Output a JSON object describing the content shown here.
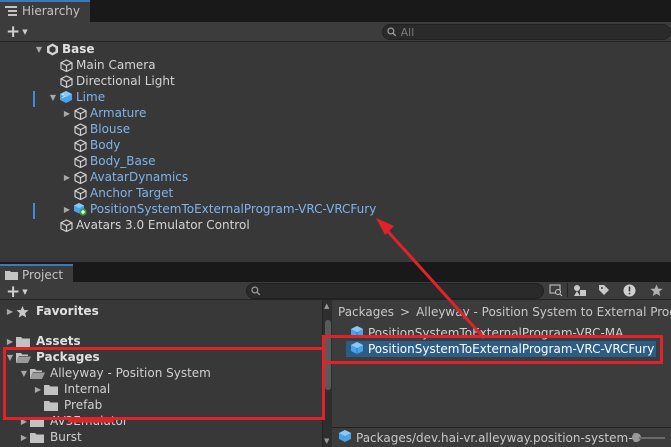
{
  "hierarchy": {
    "tab_label": "Hierarchy",
    "search_placeholder": "All",
    "rows": [
      {
        "label": "Base",
        "style": "bold",
        "icon": "unity-scene-icon",
        "arrow": "▼",
        "depth": 0
      },
      {
        "label": "Main Camera",
        "style": "white",
        "icon": "cube-outline-icon",
        "arrow": "",
        "depth": 1
      },
      {
        "label": "Directional Light",
        "style": "white",
        "icon": "cube-outline-icon",
        "arrow": "",
        "depth": 1
      },
      {
        "label": "Lime",
        "style": "blue",
        "icon": "prefab-cube-icon",
        "arrow": "▼",
        "depth": 1
      },
      {
        "label": "Armature",
        "style": "blue",
        "icon": "cube-outline-icon",
        "arrow": "▶",
        "depth": 2
      },
      {
        "label": "Blouse",
        "style": "blue",
        "icon": "cube-outline-icon",
        "arrow": "",
        "depth": 2
      },
      {
        "label": "Body",
        "style": "blue",
        "icon": "cube-outline-icon",
        "arrow": "",
        "depth": 2
      },
      {
        "label": "Body_Base",
        "style": "blue",
        "icon": "cube-outline-icon",
        "arrow": "",
        "depth": 2
      },
      {
        "label": "AvatarDynamics",
        "style": "blue",
        "icon": "cube-outline-icon",
        "arrow": "▶",
        "depth": 2
      },
      {
        "label": "Anchor Target",
        "style": "blue",
        "icon": "cube-outline-icon",
        "arrow": "",
        "depth": 2
      },
      {
        "label": "PositionSystemToExternalProgram-VRC-VRCFury",
        "style": "blue",
        "icon": "prefab-added-icon",
        "arrow": "▶",
        "depth": 2
      },
      {
        "label": "Avatars 3.0 Emulator Control",
        "style": "white",
        "icon": "cube-outline-icon",
        "arrow": "",
        "depth": 1
      }
    ]
  },
  "project": {
    "tab_label": "Project",
    "tree": [
      {
        "label": "Favorites",
        "icon": "star-icon",
        "arrow": "▶",
        "bold": true,
        "indent": 0
      },
      {
        "label": "Assets",
        "icon": "folder-icon",
        "arrow": "▶",
        "bold": true,
        "indent": 0
      },
      {
        "label": "Packages",
        "icon": "folder-open-icon",
        "arrow": "▼",
        "bold": true,
        "indent": 0
      },
      {
        "label": "Alleyway - Position System",
        "icon": "folder-open-icon",
        "arrow": "▼",
        "bold": false,
        "indent": 1
      },
      {
        "label": "Internal",
        "icon": "folder-icon",
        "arrow": "▶",
        "bold": false,
        "indent": 2
      },
      {
        "label": "Prefab",
        "icon": "folder-icon",
        "arrow": "",
        "bold": false,
        "indent": 2
      },
      {
        "label": "AV3Emulator",
        "icon": "folder-icon",
        "arrow": "▶",
        "bold": false,
        "indent": 1
      },
      {
        "label": "Burst",
        "icon": "folder-icon",
        "arrow": "▶",
        "bold": false,
        "indent": 1
      }
    ],
    "breadcrumb": [
      "Packages",
      ">",
      "Alleyway - Position System to External Program"
    ],
    "assets": [
      {
        "label": "PositionSystemToExternalProgram-VRC-MA",
        "selected": false
      },
      {
        "label": "PositionSystemToExternalProgram-VRC-VRCFury",
        "selected": true
      }
    ],
    "path": "Packages/dev.hai-vr.alleyway.position-system-to-external-program/Prefab/PositionSystemToExternalProgram-VRC-VRCFury.prefab"
  },
  "colors": {
    "annotation": "#e0232b",
    "selection": "#2c5d87",
    "prefab_blue": "#7fb3ec",
    "accent_tab": "#3a79bb"
  }
}
